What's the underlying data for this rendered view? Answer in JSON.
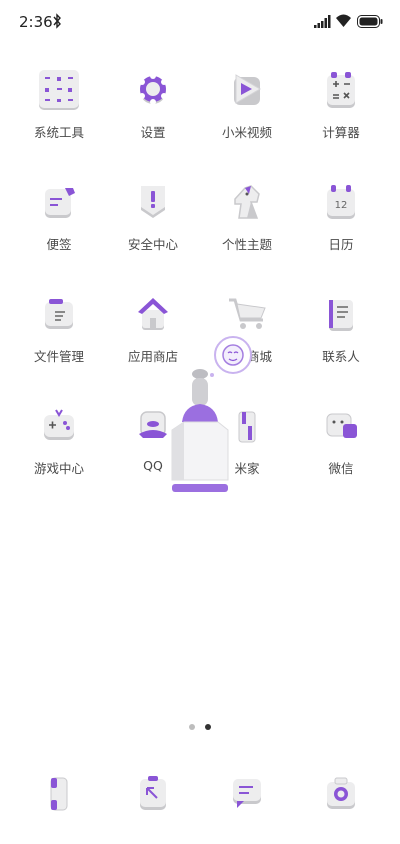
{
  "status_bar": {
    "time": "2:36"
  },
  "apps": [
    {
      "label": "系统工具",
      "icon": "folder-tools-icon"
    },
    {
      "label": "设置",
      "icon": "gear-icon"
    },
    {
      "label": "小米视频",
      "icon": "video-play-icon"
    },
    {
      "label": "计算器",
      "icon": "calculator-icon"
    },
    {
      "label": "便签",
      "icon": "notes-icon"
    },
    {
      "label": "安全中心",
      "icon": "shield-icon"
    },
    {
      "label": "个性主题",
      "icon": "theme-horse-icon"
    },
    {
      "label": "日历",
      "icon": "calendar-icon",
      "day": "12"
    },
    {
      "label": "文件管理",
      "icon": "file-manager-icon"
    },
    {
      "label": "应用商店",
      "icon": "app-store-icon"
    },
    {
      "label": "小米商城",
      "icon": "shopping-cart-icon"
    },
    {
      "label": "联系人",
      "icon": "contacts-icon"
    },
    {
      "label": "游戏中心",
      "icon": "game-controller-icon"
    },
    {
      "label": "QQ",
      "icon": "qq-icon"
    },
    {
      "label": "米家",
      "icon": "mijia-icon"
    },
    {
      "label": "微信",
      "icon": "wechat-icon"
    }
  ],
  "dock": [
    {
      "icon": "phone-icon"
    },
    {
      "icon": "browser-icon"
    },
    {
      "icon": "messages-icon"
    },
    {
      "icon": "camera-icon"
    }
  ],
  "colors": {
    "accent": "#8a55d6",
    "icon_body": "#ededee",
    "icon_shadow": "#c9c9cc"
  }
}
